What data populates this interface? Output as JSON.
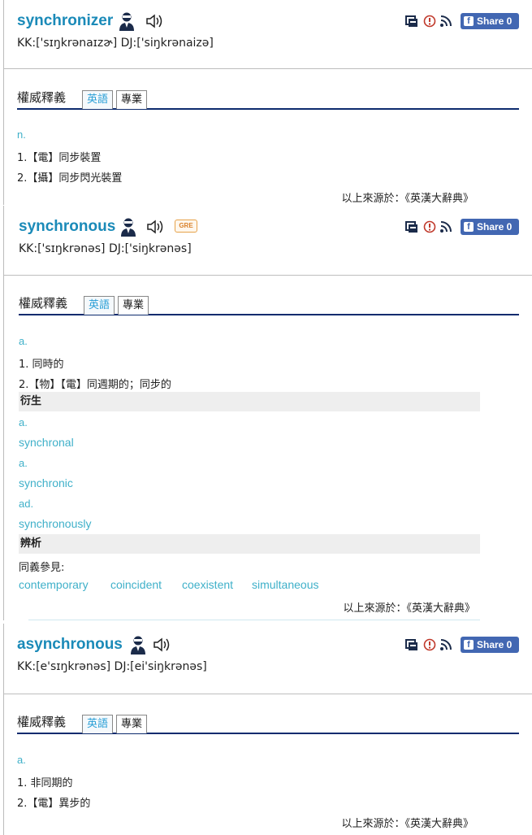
{
  "entries": [
    {
      "word": "synchronizer",
      "kk": "KK:['sɪŋkrənaɪzɚ]",
      "dj": "DJ:['siŋkrənaizə]",
      "gre": "",
      "share_label": "Share 0",
      "tabs_title": "權威釋義",
      "tab_en": "英語",
      "tab_pro": "專業",
      "pos": "n.",
      "defs": [
        "1.【電】同步裝置",
        "2.【攝】同步閃光裝置"
      ],
      "source": "以上來源於：《英漢大辭典》"
    },
    {
      "word": "synchronous",
      "kk": "KK:['sɪŋkrənəs]",
      "dj": "DJ:['siŋkrənəs]",
      "gre": "GRE",
      "share_label": "Share 0",
      "tabs_title": "權威釋義",
      "tab_en": "英語",
      "tab_pro": "專業",
      "pos": "a.",
      "defs": [
        "1. 同時的",
        "2.【物】【電】同週期的；同步的"
      ],
      "derived_title": "衍生",
      "derived": [
        {
          "pos": "a.",
          "word": "synchronal"
        },
        {
          "pos": "a.",
          "word": "synchronic"
        },
        {
          "pos": "ad.",
          "word": "synchronously"
        }
      ],
      "analysis_title": "辨析",
      "synonyms_label": "同義參見:",
      "synonyms": [
        "contemporary",
        "coincident",
        "coexistent",
        "simultaneous"
      ],
      "source": "以上來源於：《英漢大辭典》"
    },
    {
      "word": "asynchronous",
      "kk": "KK:[e'sɪŋkrənəs]",
      "dj": "DJ:[ei'siŋkrənəs]",
      "gre": "",
      "share_label": "Share 0",
      "tabs_title": "權威釋義",
      "tab_en": "英語",
      "tab_pro": "專業",
      "pos": "a.",
      "defs": [
        "1. 非同期的",
        "2.【電】異步的"
      ],
      "source": "以上來源於：《英漢大辭典》"
    }
  ],
  "icons": {
    "person": "person-icon",
    "speaker": "speaker-icon",
    "flashcard": "flashcard-icon",
    "report": "report-icon",
    "rss": "rss-icon",
    "facebook": "facebook-icon"
  },
  "colors": {
    "word": "#1a8ab8",
    "link": "#3fb0c9",
    "tab_rule": "#0d2b6e",
    "share_bg": "#4267b2",
    "gre": "#d9822b"
  }
}
